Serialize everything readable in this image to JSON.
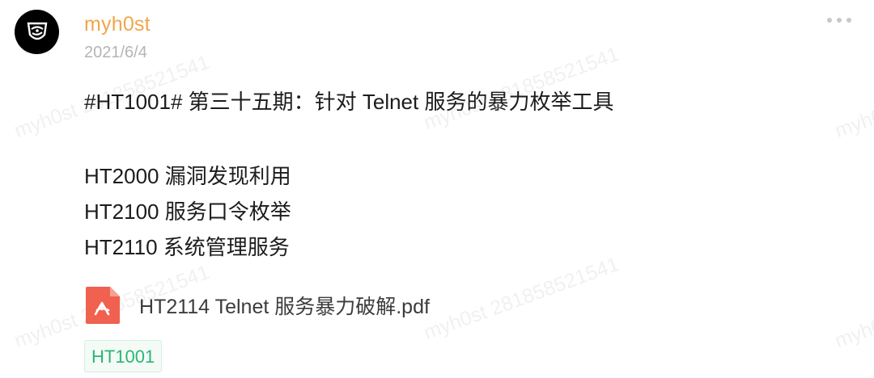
{
  "post": {
    "username": "myh0st",
    "date": "2021/6/4",
    "lines": [
      "#HT1001# 第三十五期：针对 Telnet 服务的暴力枚举工具",
      "HT2000 漏洞发现利用",
      "HT2100 服务口令枚举",
      "HT2110 系统管理服务"
    ],
    "attachment": {
      "name": "HT2114 Telnet 服务暴力破解.pdf",
      "icon": "pdf-icon"
    },
    "tag": "HT1001"
  },
  "watermark": "myh0st 281858521541",
  "colors": {
    "username": "#f0a64a",
    "tag": "#2bb673",
    "pdf": "#f0614f"
  }
}
